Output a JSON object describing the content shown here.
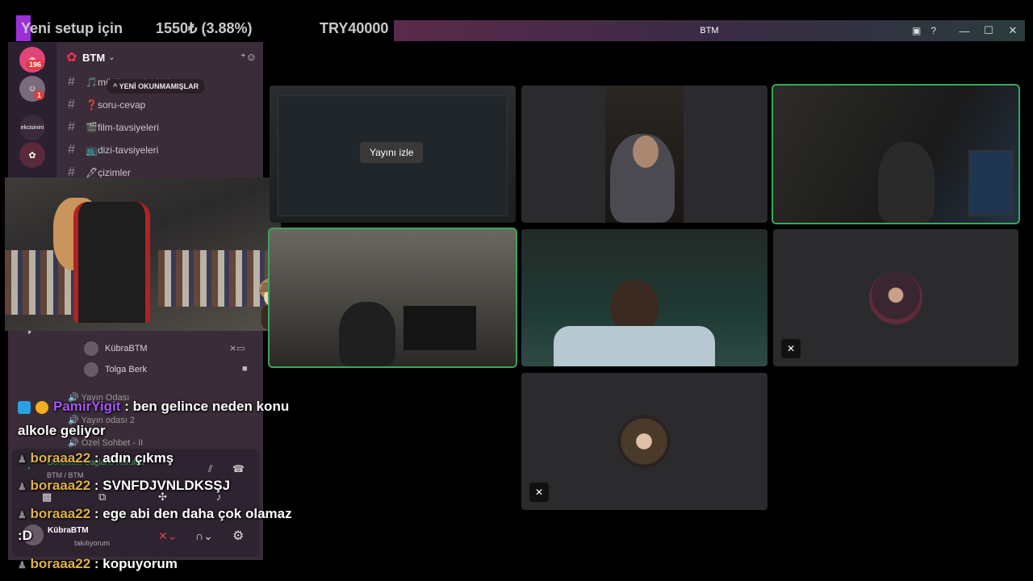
{
  "ticker": {
    "text1": "Yeni setup için",
    "text2": "1550₺ (3.88%)",
    "text3": "TRY40000"
  },
  "window": {
    "title": "BTM"
  },
  "server": {
    "name": "BTM",
    "unread_pill": "YENİ OKUNMAMIŞLAR",
    "guild_badge": "196",
    "avatar_badge": "1",
    "guild_label": "ekcisinini"
  },
  "channels": [
    {
      "emoji": "🎵",
      "name": "müzik-tavsiyeleri"
    },
    {
      "emoji": "❓",
      "name": "soru-cevap"
    },
    {
      "emoji": "🎬",
      "name": "film-tavsiyeleri"
    },
    {
      "emoji": "📺",
      "name": "dizi-tavsiyeleri"
    },
    {
      "emoji": "🖊",
      "name": "çizimler"
    }
  ],
  "voice": {
    "members": [
      {
        "name": "KübraBTM"
      },
      {
        "name": "Tolga Berk"
      }
    ],
    "channels": [
      "Yayın Odası",
      "Yayın odası 2",
      "Özel Sohbet - II"
    ]
  },
  "connection": {
    "status": "Görüntülü Bağlantı Kuruldu",
    "channel": "BTM / BTM"
  },
  "user": {
    "name": "KübraBTM",
    "status": "takılıyorum"
  },
  "stream": {
    "watch_label": "Yayını izle"
  },
  "chat": [
    {
      "user": "PamirYigit",
      "message": ": ben gelince neden konu",
      "cont": "alkole geliyor"
    },
    {
      "user": "boraaa22",
      "message": ": adın çıkmş"
    },
    {
      "user": "boraaa22",
      "message": ": SVNFDJVNLDKSŞJ"
    },
    {
      "user": "boraaa22",
      "message": ": ege abi den daha çok olamaz"
    },
    {
      "user": "boraaa22",
      "message": ": kopuyorum"
    }
  ],
  "emote_text": ":D",
  "colors": {
    "speaking_outline": "#3ba55c",
    "pamir": "#a855f7",
    "bora": "#e0b04a"
  }
}
